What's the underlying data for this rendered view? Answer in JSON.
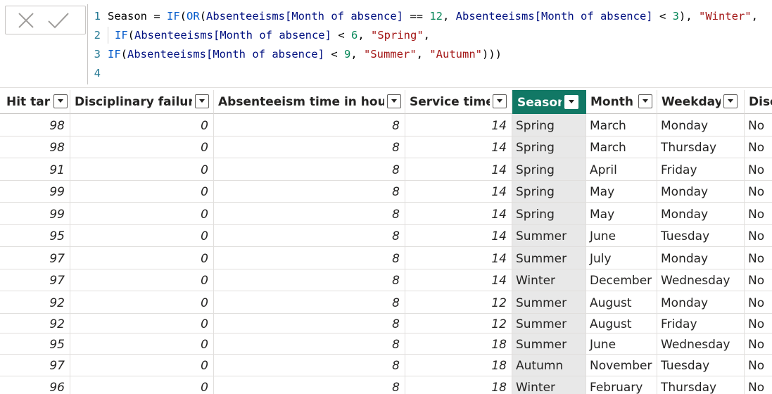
{
  "formula_bar": {
    "cancel_icon": "x-mark-icon",
    "commit_icon": "check-mark-icon",
    "line_numbers": [
      "1",
      "2",
      "3",
      "4"
    ],
    "line1": {
      "lhs": "Season",
      "eq": " = ",
      "fn1": "IF",
      "p1": "(",
      "fn2": "OR",
      "p2": "(",
      "tbl1": "Absenteeisms",
      "col1": "[Month of absence]",
      "op1": " == ",
      "n1": "12",
      "c1": ", ",
      "tbl2": "Absenteeisms",
      "col2": "[Month of absence]",
      "op2": " < ",
      "n2": "3",
      "c2": "), ",
      "s1": "\"Winter\"",
      "c3": ","
    },
    "line2": {
      "fn": "IF",
      "p": "(",
      "tbl": "Absenteeisms",
      "col": "[Month of absence]",
      "op": " < ",
      "n": "6",
      "c1": ", ",
      "s": "\"Spring\"",
      "c2": ","
    },
    "line3": {
      "fn": "IF",
      "p": "(",
      "tbl": "Absenteeisms",
      "col": "[Month of absence]",
      "op": " < ",
      "n": "9",
      "c1": ", ",
      "s1": "\"Summer\"",
      "c2": ", ",
      "s2": "\"Autumn\"",
      "close": ")))"
    }
  },
  "table": {
    "columns": [
      {
        "label": "Hit target",
        "key": "hit_target"
      },
      {
        "label": "Disciplinary failure",
        "key": "disciplinary_failure"
      },
      {
        "label": "Absenteeism time in hours",
        "key": "absenteeism_hours"
      },
      {
        "label": "Service time",
        "key": "service_time"
      },
      {
        "label": "Season",
        "key": "season",
        "selected": true
      },
      {
        "label": "Month",
        "key": "month"
      },
      {
        "label": "Weekday",
        "key": "weekday"
      },
      {
        "label": "Disciplinary",
        "key": "disc"
      }
    ],
    "rows": [
      [
        "98",
        "0",
        "8",
        "14",
        "Spring",
        "March",
        "Monday",
        "No"
      ],
      [
        "98",
        "0",
        "8",
        "14",
        "Spring",
        "March",
        "Thursday",
        "No"
      ],
      [
        "91",
        "0",
        "8",
        "14",
        "Spring",
        "April",
        "Friday",
        "No"
      ],
      [
        "99",
        "0",
        "8",
        "14",
        "Spring",
        "May",
        "Monday",
        "No"
      ],
      [
        "99",
        "0",
        "8",
        "14",
        "Spring",
        "May",
        "Monday",
        "No"
      ],
      [
        "95",
        "0",
        "8",
        "14",
        "Summer",
        "June",
        "Tuesday",
        "No"
      ],
      [
        "97",
        "0",
        "8",
        "14",
        "Summer",
        "July",
        "Monday",
        "No"
      ],
      [
        "97",
        "0",
        "8",
        "14",
        "Winter",
        "December",
        "Wednesday",
        "No"
      ],
      [
        "92",
        "0",
        "8",
        "12",
        "Summer",
        "August",
        "Monday",
        "No"
      ],
      [
        "92",
        "0",
        "8",
        "12",
        "Summer",
        "August",
        "Friday",
        "No"
      ],
      [
        "95",
        "0",
        "8",
        "18",
        "Summer",
        "June",
        "Wednesday",
        "No"
      ],
      [
        "97",
        "0",
        "8",
        "18",
        "Autumn",
        "November",
        "Tuesday",
        "No"
      ],
      [
        "96",
        "0",
        "8",
        "18",
        "Winter",
        "February",
        "Thursday",
        "No"
      ]
    ]
  },
  "colors": {
    "accent": "#117865",
    "selected_column_fill": "#e8e8e8"
  }
}
